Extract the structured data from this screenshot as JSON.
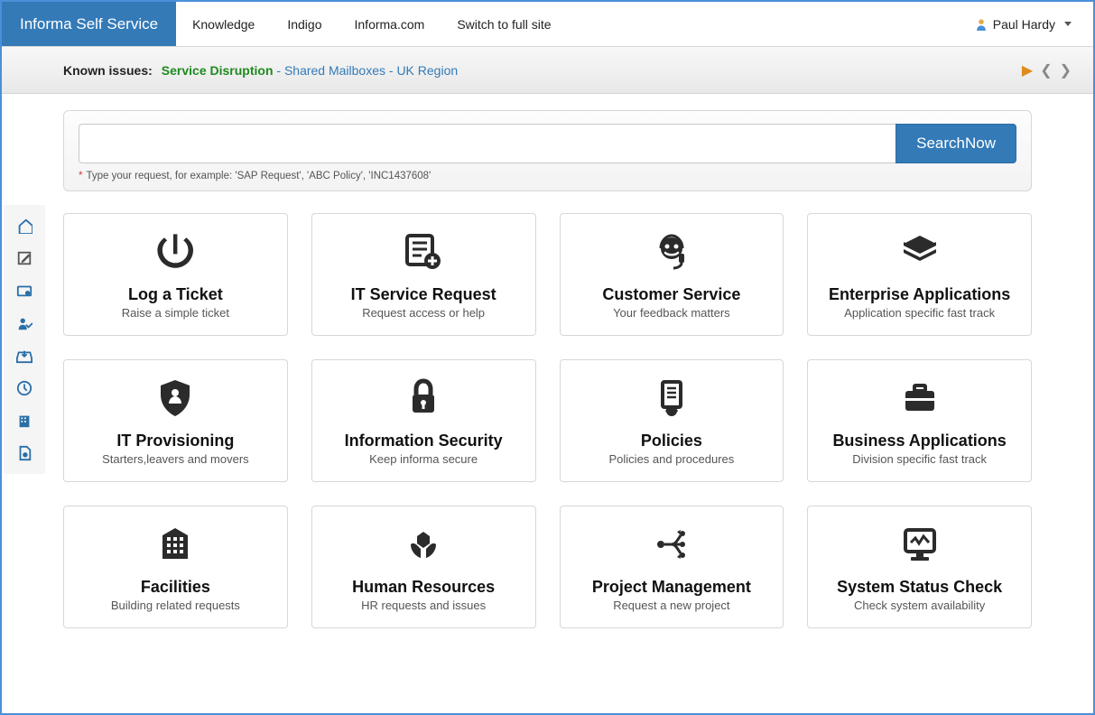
{
  "brand": "Informa Self Service",
  "nav": {
    "links": [
      "Knowledge",
      "Indigo",
      "Informa.com",
      "Switch to full site"
    ],
    "user": "Paul Hardy"
  },
  "issues": {
    "label": "Known issues:",
    "kind": "Service Disruption",
    "detail": " - Shared Mailboxes - UK Region"
  },
  "search": {
    "button": "SearchNow",
    "value": "",
    "hint": "Type your request, for example: 'SAP Request', 'ABC Policy', 'INC1437608'"
  },
  "rail": [
    "home-icon",
    "edit-icon",
    "card-icon",
    "person-check-icon",
    "inbox-icon",
    "clock-icon",
    "building-icon",
    "doc-icon"
  ],
  "cards": [
    {
      "icon": "power",
      "title": "Log a Ticket",
      "sub": "Raise a simple ticket"
    },
    {
      "icon": "listplus",
      "title": "IT Service Request",
      "sub": "Request access or help"
    },
    {
      "icon": "headset",
      "title": "Customer Service",
      "sub": "Your feedback matters"
    },
    {
      "icon": "layers",
      "title": "Enterprise Applications",
      "sub": "Application specific fast track"
    },
    {
      "icon": "shield",
      "title": "IT Provisioning",
      "sub": "Starters,leavers and movers"
    },
    {
      "icon": "lock",
      "title": "Information Security",
      "sub": "Keep informa secure"
    },
    {
      "icon": "scroll",
      "title": "Policies",
      "sub": "Policies and procedures"
    },
    {
      "icon": "briefcase",
      "title": "Business Applications",
      "sub": "Division specific fast track"
    },
    {
      "icon": "building",
      "title": "Facilities",
      "sub": "Building related requests"
    },
    {
      "icon": "hands",
      "title": "Human Resources",
      "sub": "HR requests and issues"
    },
    {
      "icon": "flow",
      "title": "Project Management",
      "sub": "Request a new project"
    },
    {
      "icon": "monitor",
      "title": "System Status Check",
      "sub": "Check system availability"
    }
  ]
}
